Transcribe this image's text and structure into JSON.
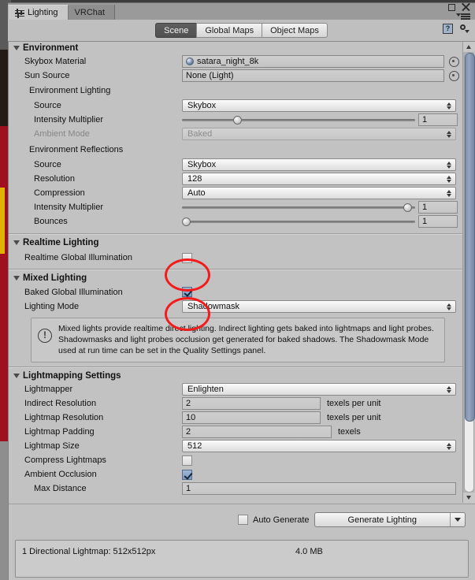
{
  "window": {
    "tabs": [
      {
        "label": "Lighting",
        "icon": "lighting-sliders-icon",
        "active": true
      },
      {
        "label": "VRChat",
        "icon": "",
        "active": false
      }
    ],
    "buttons": {
      "maximize": "maximize-icon",
      "close": "close-icon",
      "menu": "window-menu-icon"
    }
  },
  "toolbar": {
    "modes": [
      {
        "label": "Scene",
        "active": true
      },
      {
        "label": "Global Maps",
        "active": false
      },
      {
        "label": "Object Maps",
        "active": false
      }
    ],
    "help_label": "?",
    "gear_label": "gear-icon"
  },
  "environment": {
    "header": "Environment",
    "skybox_material": {
      "label": "Skybox Material",
      "value": "satara_night_8k"
    },
    "sun_source": {
      "label": "Sun Source",
      "value": "None (Light)"
    },
    "lighting_group": "Environment Lighting",
    "lighting": {
      "source": {
        "label": "Source",
        "value": "Skybox"
      },
      "intensity": {
        "label": "Intensity Multiplier",
        "value": "1",
        "percent": 25
      },
      "ambient_mode": {
        "label": "Ambient Mode",
        "value": "Baked",
        "disabled": true
      }
    },
    "reflections_group": "Environment Reflections",
    "reflections": {
      "source": {
        "label": "Source",
        "value": "Skybox"
      },
      "resolution": {
        "label": "Resolution",
        "value": "128"
      },
      "compression": {
        "label": "Compression",
        "value": "Auto"
      },
      "intensity": {
        "label": "Intensity Multiplier",
        "value": "1",
        "percent": 97
      },
      "bounces": {
        "label": "Bounces",
        "value": "1",
        "percent": 1
      }
    }
  },
  "realtime_lighting": {
    "header": "Realtime Lighting",
    "realtime_gi": {
      "label": "Realtime Global Illumination",
      "checked": false
    }
  },
  "mixed_lighting": {
    "header": "Mixed Lighting",
    "baked_gi": {
      "label": "Baked Global Illumination",
      "checked": true
    },
    "lighting_mode": {
      "label": "Lighting Mode",
      "value": "Shadowmask"
    },
    "info": "Mixed lights provide realtime direct lighting. Indirect lighting gets baked into lightmaps and light probes. Shadowmasks and light probes occlusion get generated for baked shadows. The Shadowmask Mode used at run time can be set in the Quality Settings panel.",
    "info_icon": "!"
  },
  "lightmapping": {
    "header": "Lightmapping Settings",
    "lightmapper": {
      "label": "Lightmapper",
      "value": "Enlighten"
    },
    "indirect_resolution": {
      "label": "Indirect Resolution",
      "value": "2",
      "unit": "texels per unit"
    },
    "lightmap_resolution": {
      "label": "Lightmap Resolution",
      "value": "10",
      "unit": "texels per unit"
    },
    "lightmap_padding": {
      "label": "Lightmap Padding",
      "value": "2",
      "unit": "texels"
    },
    "lightmap_size": {
      "label": "Lightmap Size",
      "value": "512"
    },
    "compress_lightmaps": {
      "label": "Compress Lightmaps",
      "checked": false
    },
    "ambient_occlusion": {
      "label": "Ambient Occlusion",
      "checked": true
    },
    "max_distance": {
      "label": "Max Distance",
      "value": "1"
    }
  },
  "footer": {
    "auto_generate": {
      "label": "Auto Generate",
      "checked": false
    },
    "generate_button": "Generate Lighting",
    "generate_dropdown": "chevron-down-icon"
  },
  "status": {
    "lightmap_info": "1 Directional Lightmap: 512x512px",
    "memory": "4.0 MB"
  },
  "colors": {
    "accent_red": "#f41b1b",
    "panel_bg": "#c2c2c2",
    "checkbox_checked": "#8fa9cb"
  }
}
